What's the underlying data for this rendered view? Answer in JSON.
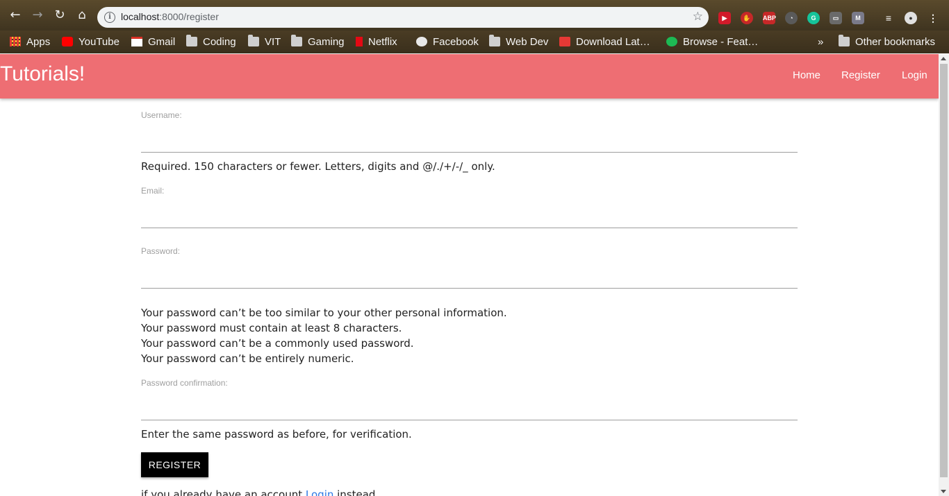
{
  "browser": {
    "url_host": "localhost",
    "url_path": ":8000/register",
    "bookmarks": [
      "Apps",
      "YouTube",
      "Gmail",
      "Coding",
      "VIT",
      "Gaming",
      "Netflix",
      "Facebook",
      "Web Dev",
      "Download Lat…",
      "Browse - Feat…"
    ],
    "other_bookmarks": "Other bookmarks",
    "overflow": "»"
  },
  "navbar": {
    "brand": "Tutorials!",
    "links": [
      "Home",
      "Register",
      "Login"
    ]
  },
  "form": {
    "username_label": "Username:",
    "username_help": "Required. 150 characters or fewer. Letters, digits and @/./+/-/_ only.",
    "email_label": "Email:",
    "password_label": "Password:",
    "password_help": [
      "Your password can’t be too similar to your other personal information.",
      "Your password must contain at least 8 characters.",
      "Your password can’t be a commonly used password.",
      "Your password can’t be entirely numeric."
    ],
    "password_confirm_label": "Password confirmation:",
    "password_confirm_help": "Enter the same password as before, for verification.",
    "submit_label": "REGISTER",
    "footer_prefix": "if you already have an account ",
    "footer_link": "Login",
    "footer_suffix": " instead"
  },
  "colors": {
    "navbar": "#ee6e73",
    "button": "#000000",
    "link": "#2b78e4"
  }
}
